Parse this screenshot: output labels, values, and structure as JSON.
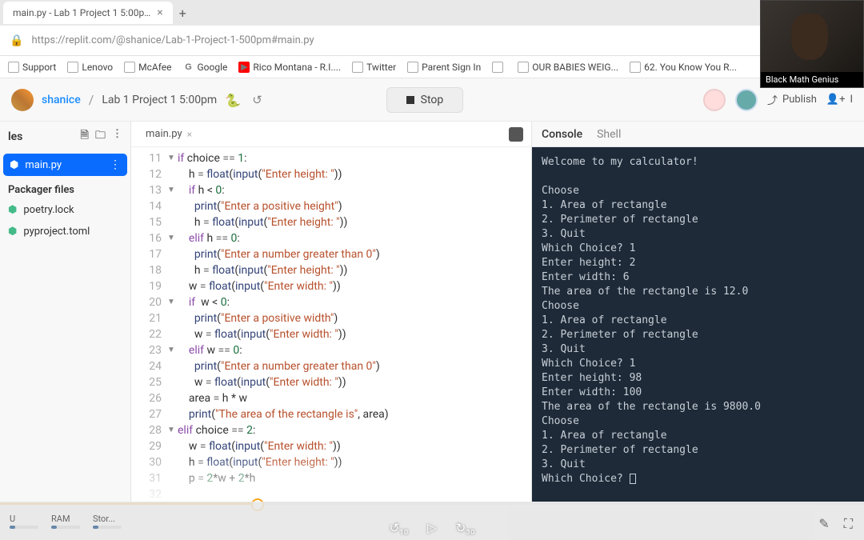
{
  "browser": {
    "tab_title": "main.py - Lab 1 Project 1 5:00p…",
    "url": "https://replit.com/@shanice/Lab-1-Project-1-500pm#main.py",
    "bookmarks": [
      "Support",
      "Lenovo",
      "McAfee",
      "Google",
      "Rico Montana - R.I....",
      "Twitter",
      "Parent Sign In",
      "",
      "OUR BABIES WEIG...",
      "62. You Know You R..."
    ]
  },
  "header": {
    "user": "shanice",
    "project": "Lab 1 Project 1 5:00pm",
    "stop_label": "Stop",
    "publish_label": "Publish",
    "invite_label": "I"
  },
  "sidebar": {
    "title": "les",
    "active_file": "main.py",
    "section": "Packager files",
    "files": [
      "poetry.lock",
      "pyproject.toml"
    ]
  },
  "editor": {
    "tab": "main.py",
    "lines": [
      {
        "n": 11,
        "f": "▼",
        "t": "if choice == 1:",
        "tok": [
          [
            "kw",
            "if"
          ],
          [
            "",
            " choice "
          ],
          [
            "op",
            "=="
          ],
          [
            "",
            " "
          ],
          [
            "num",
            "1"
          ],
          [
            "",
            ":"
          ]
        ]
      },
      {
        "n": 12,
        "f": "",
        "t": "    h = float(input(\"Enter height: \"))",
        "tok": [
          [
            "",
            "    h "
          ],
          [
            "op",
            "="
          ],
          [
            "",
            " "
          ],
          [
            "fn",
            "float"
          ],
          [
            "",
            "("
          ],
          [
            "fn",
            "input"
          ],
          [
            "",
            "("
          ],
          [
            "str",
            "\"Enter height: \""
          ],
          [
            "",
            "))"
          ]
        ]
      },
      {
        "n": 13,
        "f": "▼",
        "t": "    if h < 0:",
        "tok": [
          [
            "",
            "    "
          ],
          [
            "kw",
            "if"
          ],
          [
            "",
            " h < "
          ],
          [
            "num",
            "0"
          ],
          [
            "",
            ":"
          ]
        ]
      },
      {
        "n": 14,
        "f": "",
        "t": "      print(\"Enter a positive height\")",
        "tok": [
          [
            "",
            "      "
          ],
          [
            "fn",
            "print"
          ],
          [
            "",
            "("
          ],
          [
            "str",
            "\"Enter a positive height\""
          ],
          [
            "",
            ")"
          ]
        ]
      },
      {
        "n": 15,
        "f": "",
        "t": "      h = float(input(\"Enter height: \"))",
        "tok": [
          [
            "",
            "      h "
          ],
          [
            "op",
            "="
          ],
          [
            "",
            " "
          ],
          [
            "fn",
            "float"
          ],
          [
            "",
            "("
          ],
          [
            "fn",
            "input"
          ],
          [
            "",
            "("
          ],
          [
            "str",
            "\"Enter height: \""
          ],
          [
            "",
            "))"
          ]
        ]
      },
      {
        "n": 16,
        "f": "▼",
        "t": "    elif h == 0:",
        "tok": [
          [
            "",
            "    "
          ],
          [
            "kw",
            "elif"
          ],
          [
            "",
            " h "
          ],
          [
            "op",
            "=="
          ],
          [
            "",
            " "
          ],
          [
            "num",
            "0"
          ],
          [
            "",
            ":"
          ]
        ]
      },
      {
        "n": 17,
        "f": "",
        "t": "      print(\"Enter a number greater than 0\")",
        "tok": [
          [
            "",
            "      "
          ],
          [
            "fn",
            "print"
          ],
          [
            "",
            "("
          ],
          [
            "str",
            "\"Enter a number greater than 0\""
          ],
          [
            "",
            ")"
          ]
        ]
      },
      {
        "n": 18,
        "f": "",
        "t": "      h = float(input(\"Enter height: \"))",
        "tok": [
          [
            "",
            "      h "
          ],
          [
            "op",
            "="
          ],
          [
            "",
            " "
          ],
          [
            "fn",
            "float"
          ],
          [
            "",
            "("
          ],
          [
            "fn",
            "input"
          ],
          [
            "",
            "("
          ],
          [
            "str",
            "\"Enter height: \""
          ],
          [
            "",
            "))"
          ]
        ]
      },
      {
        "n": 19,
        "f": "",
        "t": "    w = float(input(\"Enter width: \"))",
        "tok": [
          [
            "",
            "    w "
          ],
          [
            "op",
            "="
          ],
          [
            "",
            " "
          ],
          [
            "fn",
            "float"
          ],
          [
            "",
            "("
          ],
          [
            "fn",
            "input"
          ],
          [
            "",
            "("
          ],
          [
            "str",
            "\"Enter width: \""
          ],
          [
            "",
            "))"
          ]
        ]
      },
      {
        "n": 20,
        "f": "▼",
        "t": "    if  w < 0:",
        "tok": [
          [
            "",
            "    "
          ],
          [
            "kw",
            "if"
          ],
          [
            "",
            "  w < "
          ],
          [
            "num",
            "0"
          ],
          [
            "",
            ":"
          ]
        ]
      },
      {
        "n": 21,
        "f": "",
        "t": "      print(\"Enter a positive width\")",
        "tok": [
          [
            "",
            "      "
          ],
          [
            "fn",
            "print"
          ],
          [
            "",
            "("
          ],
          [
            "str",
            "\"Enter a positive width\""
          ],
          [
            "",
            ")"
          ]
        ]
      },
      {
        "n": 22,
        "f": "",
        "t": "      w = float(input(\"Enter width: \"))",
        "tok": [
          [
            "",
            "      w "
          ],
          [
            "op",
            "="
          ],
          [
            "",
            " "
          ],
          [
            "fn",
            "float"
          ],
          [
            "",
            "("
          ],
          [
            "fn",
            "input"
          ],
          [
            "",
            "("
          ],
          [
            "str",
            "\"Enter width: \""
          ],
          [
            "",
            "))"
          ]
        ]
      },
      {
        "n": 23,
        "f": "▼",
        "t": "    elif w == 0:",
        "tok": [
          [
            "",
            "    "
          ],
          [
            "kw",
            "elif"
          ],
          [
            "",
            " w "
          ],
          [
            "op",
            "=="
          ],
          [
            "",
            " "
          ],
          [
            "num",
            "0"
          ],
          [
            "",
            ":"
          ]
        ]
      },
      {
        "n": 24,
        "f": "",
        "t": "      print(\"Enter a number greater than 0\")",
        "tok": [
          [
            "",
            "      "
          ],
          [
            "fn",
            "print"
          ],
          [
            "",
            "("
          ],
          [
            "str",
            "\"Enter a number greater than 0\""
          ],
          [
            "",
            ")"
          ]
        ]
      },
      {
        "n": 25,
        "f": "",
        "t": "      w = float(input(\"Enter width: \"))",
        "tok": [
          [
            "",
            "      w "
          ],
          [
            "op",
            "="
          ],
          [
            "",
            " "
          ],
          [
            "fn",
            "float"
          ],
          [
            "",
            "("
          ],
          [
            "fn",
            "input"
          ],
          [
            "",
            "("
          ],
          [
            "str",
            "\"Enter width: \""
          ],
          [
            "",
            "))"
          ]
        ]
      },
      {
        "n": 26,
        "f": "",
        "t": "    area = h * w",
        "tok": [
          [
            "",
            "    area "
          ],
          [
            "op",
            "="
          ],
          [
            "",
            " h * w"
          ]
        ]
      },
      {
        "n": 27,
        "f": "",
        "t": "    print(\"The area of the rectangle is\", area)",
        "tok": [
          [
            "",
            "    "
          ],
          [
            "fn",
            "print"
          ],
          [
            "",
            "("
          ],
          [
            "str",
            "\"The area of the rectangle is\""
          ],
          [
            "",
            ", area)"
          ]
        ]
      },
      {
        "n": 28,
        "f": "▼",
        "t": "elif choice == 2:",
        "tok": [
          [
            "kw",
            "elif"
          ],
          [
            "",
            " choice "
          ],
          [
            "op",
            "=="
          ],
          [
            "",
            " "
          ],
          [
            "num",
            "2"
          ],
          [
            "",
            ":"
          ]
        ]
      },
      {
        "n": 29,
        "f": "",
        "t": "    w = float(input(\"Enter width: \"))",
        "tok": [
          [
            "",
            "    w "
          ],
          [
            "op",
            "="
          ],
          [
            "",
            " "
          ],
          [
            "fn",
            "float"
          ],
          [
            "",
            "("
          ],
          [
            "fn",
            "input"
          ],
          [
            "",
            "("
          ],
          [
            "str",
            "\"Enter width: \""
          ],
          [
            "",
            "))"
          ]
        ]
      },
      {
        "n": 30,
        "f": "",
        "t": "    h = float(input(\"Enter height: \"))",
        "tok": [
          [
            "",
            "    h "
          ],
          [
            "op",
            "="
          ],
          [
            "",
            " "
          ],
          [
            "fn",
            "float"
          ],
          [
            "",
            "("
          ],
          [
            "fn",
            "input"
          ],
          [
            "",
            "("
          ],
          [
            "str",
            "\"Enter height: \""
          ],
          [
            "",
            "))"
          ]
        ]
      },
      {
        "n": 31,
        "f": "",
        "t": "    p = 2*w + 2*h",
        "tok": [
          [
            "",
            "    p "
          ],
          [
            "op",
            "="
          ],
          [
            "",
            " "
          ],
          [
            "num",
            "2"
          ],
          [
            "",
            "*w + "
          ],
          [
            "num",
            "2"
          ],
          [
            "",
            "*h"
          ]
        ]
      },
      {
        "n": 32,
        "f": "",
        "t": "",
        "tok": [
          [
            "",
            ""
          ]
        ]
      }
    ]
  },
  "console": {
    "tab_console": "Console",
    "tab_shell": "Shell",
    "lines": [
      "Welcome to my calculator!",
      "",
      "Choose",
      "1. Area of rectangle",
      "2. Perimeter of rectangle",
      "3. Quit",
      "Which Choice? 1",
      "Enter height: 2",
      "Enter width: 6",
      "The area of the rectangle is 12.0",
      "Choose",
      "1. Area of rectangle",
      "2. Perimeter of rectangle",
      "3. Quit",
      "Which Choice? 1",
      "Enter height: 98",
      "Enter width: 100",
      "The area of the rectangle is 9800.0",
      "Choose",
      "1. Area of rectangle",
      "2. Perimeter of rectangle",
      "3. Quit",
      "Which Choice? "
    ]
  },
  "footer": {
    "metrics": [
      "U",
      "RAM",
      "Stor..."
    ]
  },
  "pip": {
    "label": "Black Math Genius"
  }
}
